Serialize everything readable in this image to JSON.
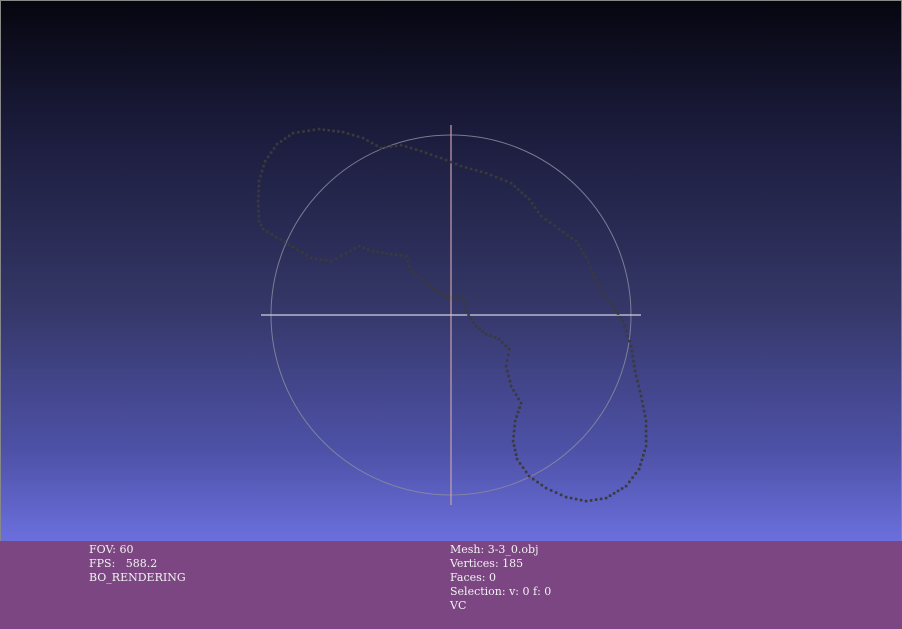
{
  "viewer": {
    "colors": {
      "background_top": "#060610",
      "background_bottom": "#6b6fdc",
      "info_bar": "#7b4682",
      "trackball": "#8a8aa0",
      "vertical_axis": "#c8a0b0",
      "horizontal_axis": "#d0d0e0",
      "points": "#3a3a3a"
    }
  },
  "info_left": {
    "fov": "FOV: 60",
    "fps": "FPS:   588.2",
    "mode": "BO_RENDERING"
  },
  "info_right": {
    "mesh": "Mesh: 3-3_0.obj",
    "vertices": "Vertices: 185",
    "faces": "Faces: 0",
    "selection": "Selection: v: 0 f: 0",
    "vc": "VC"
  }
}
